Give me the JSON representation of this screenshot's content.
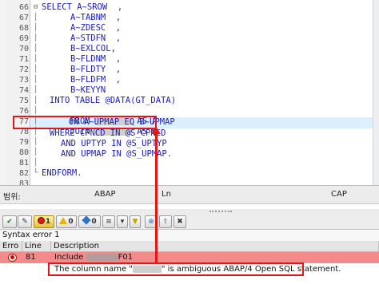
{
  "editor": {
    "line_numbers": [
      "66",
      "67",
      "68",
      "69",
      "70",
      "71",
      "72",
      "73",
      "74",
      "75",
      "76",
      "77",
      "78",
      "79",
      "80",
      "81",
      "82",
      "83"
    ],
    "lines": [
      {
        "text": "SELECT A~SROW  ,",
        "indent": 0
      },
      {
        "text": "A~TABNM  ,",
        "indent": 5
      },
      {
        "text": "A~ZDESC  ,",
        "indent": 5
      },
      {
        "text": "A~STDFN  ,",
        "indent": 5
      },
      {
        "text": "B~EXLCOL,",
        "indent": 5
      },
      {
        "text": "B~FLDNM  ,",
        "indent": 5
      },
      {
        "text": "B~FLDTY  ,",
        "indent": 5
      },
      {
        "text": "B~FLDFM  ,",
        "indent": 5
      },
      {
        "text": "B~KEYYN",
        "indent": 5
      },
      {
        "text": "INTO TABLE @DATA(GT_DATA)",
        "indent": 1
      },
      {
        "text": "FROM",
        "indent": 1,
        "masked": true,
        "suffix": "AS A"
      },
      {
        "text": "JOIN",
        "indent": 1,
        "masked": true,
        "suffix": "AS B"
      },
      {
        "text": "ON A~UPMAP EQ B~UPMAP",
        "indent": 3
      },
      {
        "text": "WHERE CPNCD IN @S_CPNCD",
        "indent": 1
      },
      {
        "text": "AND UPTYP IN @S_UPTYP",
        "indent": 3
      },
      {
        "text": "AND UPMAP IN @S_UPMAP.",
        "indent": 3
      },
      {
        "text": "",
        "indent": 0
      },
      {
        "text": "ENDFORM.",
        "indent": 0
      }
    ]
  },
  "statusbar": {
    "range_label": "범위:",
    "language": "ABAP",
    "ln_label": "Ln",
    "caps": "CAP"
  },
  "toolbar": {
    "error_count": "1",
    "warning_count": "0",
    "info_count": "0"
  },
  "errors": {
    "title": "Syntax error 1",
    "columns": [
      "Erro",
      "Line",
      "Description"
    ],
    "rows": [
      {
        "line": "81",
        "description": "Include",
        "description_suffix": "F01"
      }
    ],
    "message_prefix": "The column name \"",
    "message_suffix": "\" is ambiguous ABAP/4 Open SQL statement."
  },
  "colors": {
    "keyword": "#1c1cb4",
    "highlight_line": "#dcefff",
    "error_row": "#f48a8a",
    "annotation": "#e01818"
  }
}
